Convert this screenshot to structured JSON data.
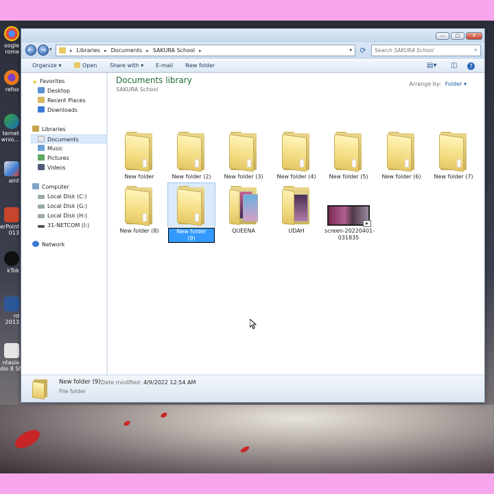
{
  "desktop_icons": [
    {
      "label": "oogle\nrome",
      "color": "#e0473a"
    },
    {
      "label": "refox",
      "color": "#ea7a1d"
    },
    {
      "label": "ternet\nwnlo...",
      "color": "#3aa33a"
    },
    {
      "label": "aint",
      "color": "#3b7bd4"
    },
    {
      "label": "erPoint\n013",
      "color": "#c8452d"
    },
    {
      "label": "kTok",
      "color": "#111111"
    },
    {
      "label": "rd 2013",
      "color": "#2b5797"
    },
    {
      "label": "ntasia\ndio 8 SN",
      "color": "#e6e6e6"
    }
  ],
  "address": {
    "crumbs": [
      "Libraries",
      "Documents",
      "SAKURA School"
    ],
    "search_placeholder": "Search SAKURA School"
  },
  "toolbar": {
    "organize": "Organize ▾",
    "open": "Open",
    "share": "Share with ▾",
    "email": "E-mail",
    "new_folder": "New folder"
  },
  "nav": {
    "favorites": "Favorites",
    "desktop": "Desktop",
    "recent": "Recent Places",
    "downloads": "Downloads",
    "libraries": "Libraries",
    "documents": "Documents",
    "music": "Music",
    "pictures": "Pictures",
    "videos": "Videos",
    "computer": "Computer",
    "disk_c": "Local Disk (C:)",
    "disk_g": "Local Disk (G:)",
    "disk_h": "Local Disk (H:)",
    "netcom": "31-NETCOM (I:)",
    "network": "Network"
  },
  "content": {
    "title": "Documents library",
    "subtitle": "SAKURA School",
    "arrange_label": "Arrange by:",
    "arrange_value": "Folder ▾",
    "items": [
      "New folder",
      "New folder (2)",
      "New folder (3)",
      "New folder (4)",
      "New folder (5)",
      "New folder (6)",
      "New folder (7)",
      "New folder (8)",
      "New folder (9)",
      "QUEENA",
      "UDAH",
      "screen-20220401-\n031835"
    ]
  },
  "status": {
    "name": "New folder (9)",
    "modified_label": "Date modified:",
    "modified_value": "4/9/2022 12:54 AM",
    "type": "File folder"
  },
  "colors": {
    "library_title": "#1e6b38",
    "selection": "#dcebfc",
    "folder": "#f3dc82"
  }
}
